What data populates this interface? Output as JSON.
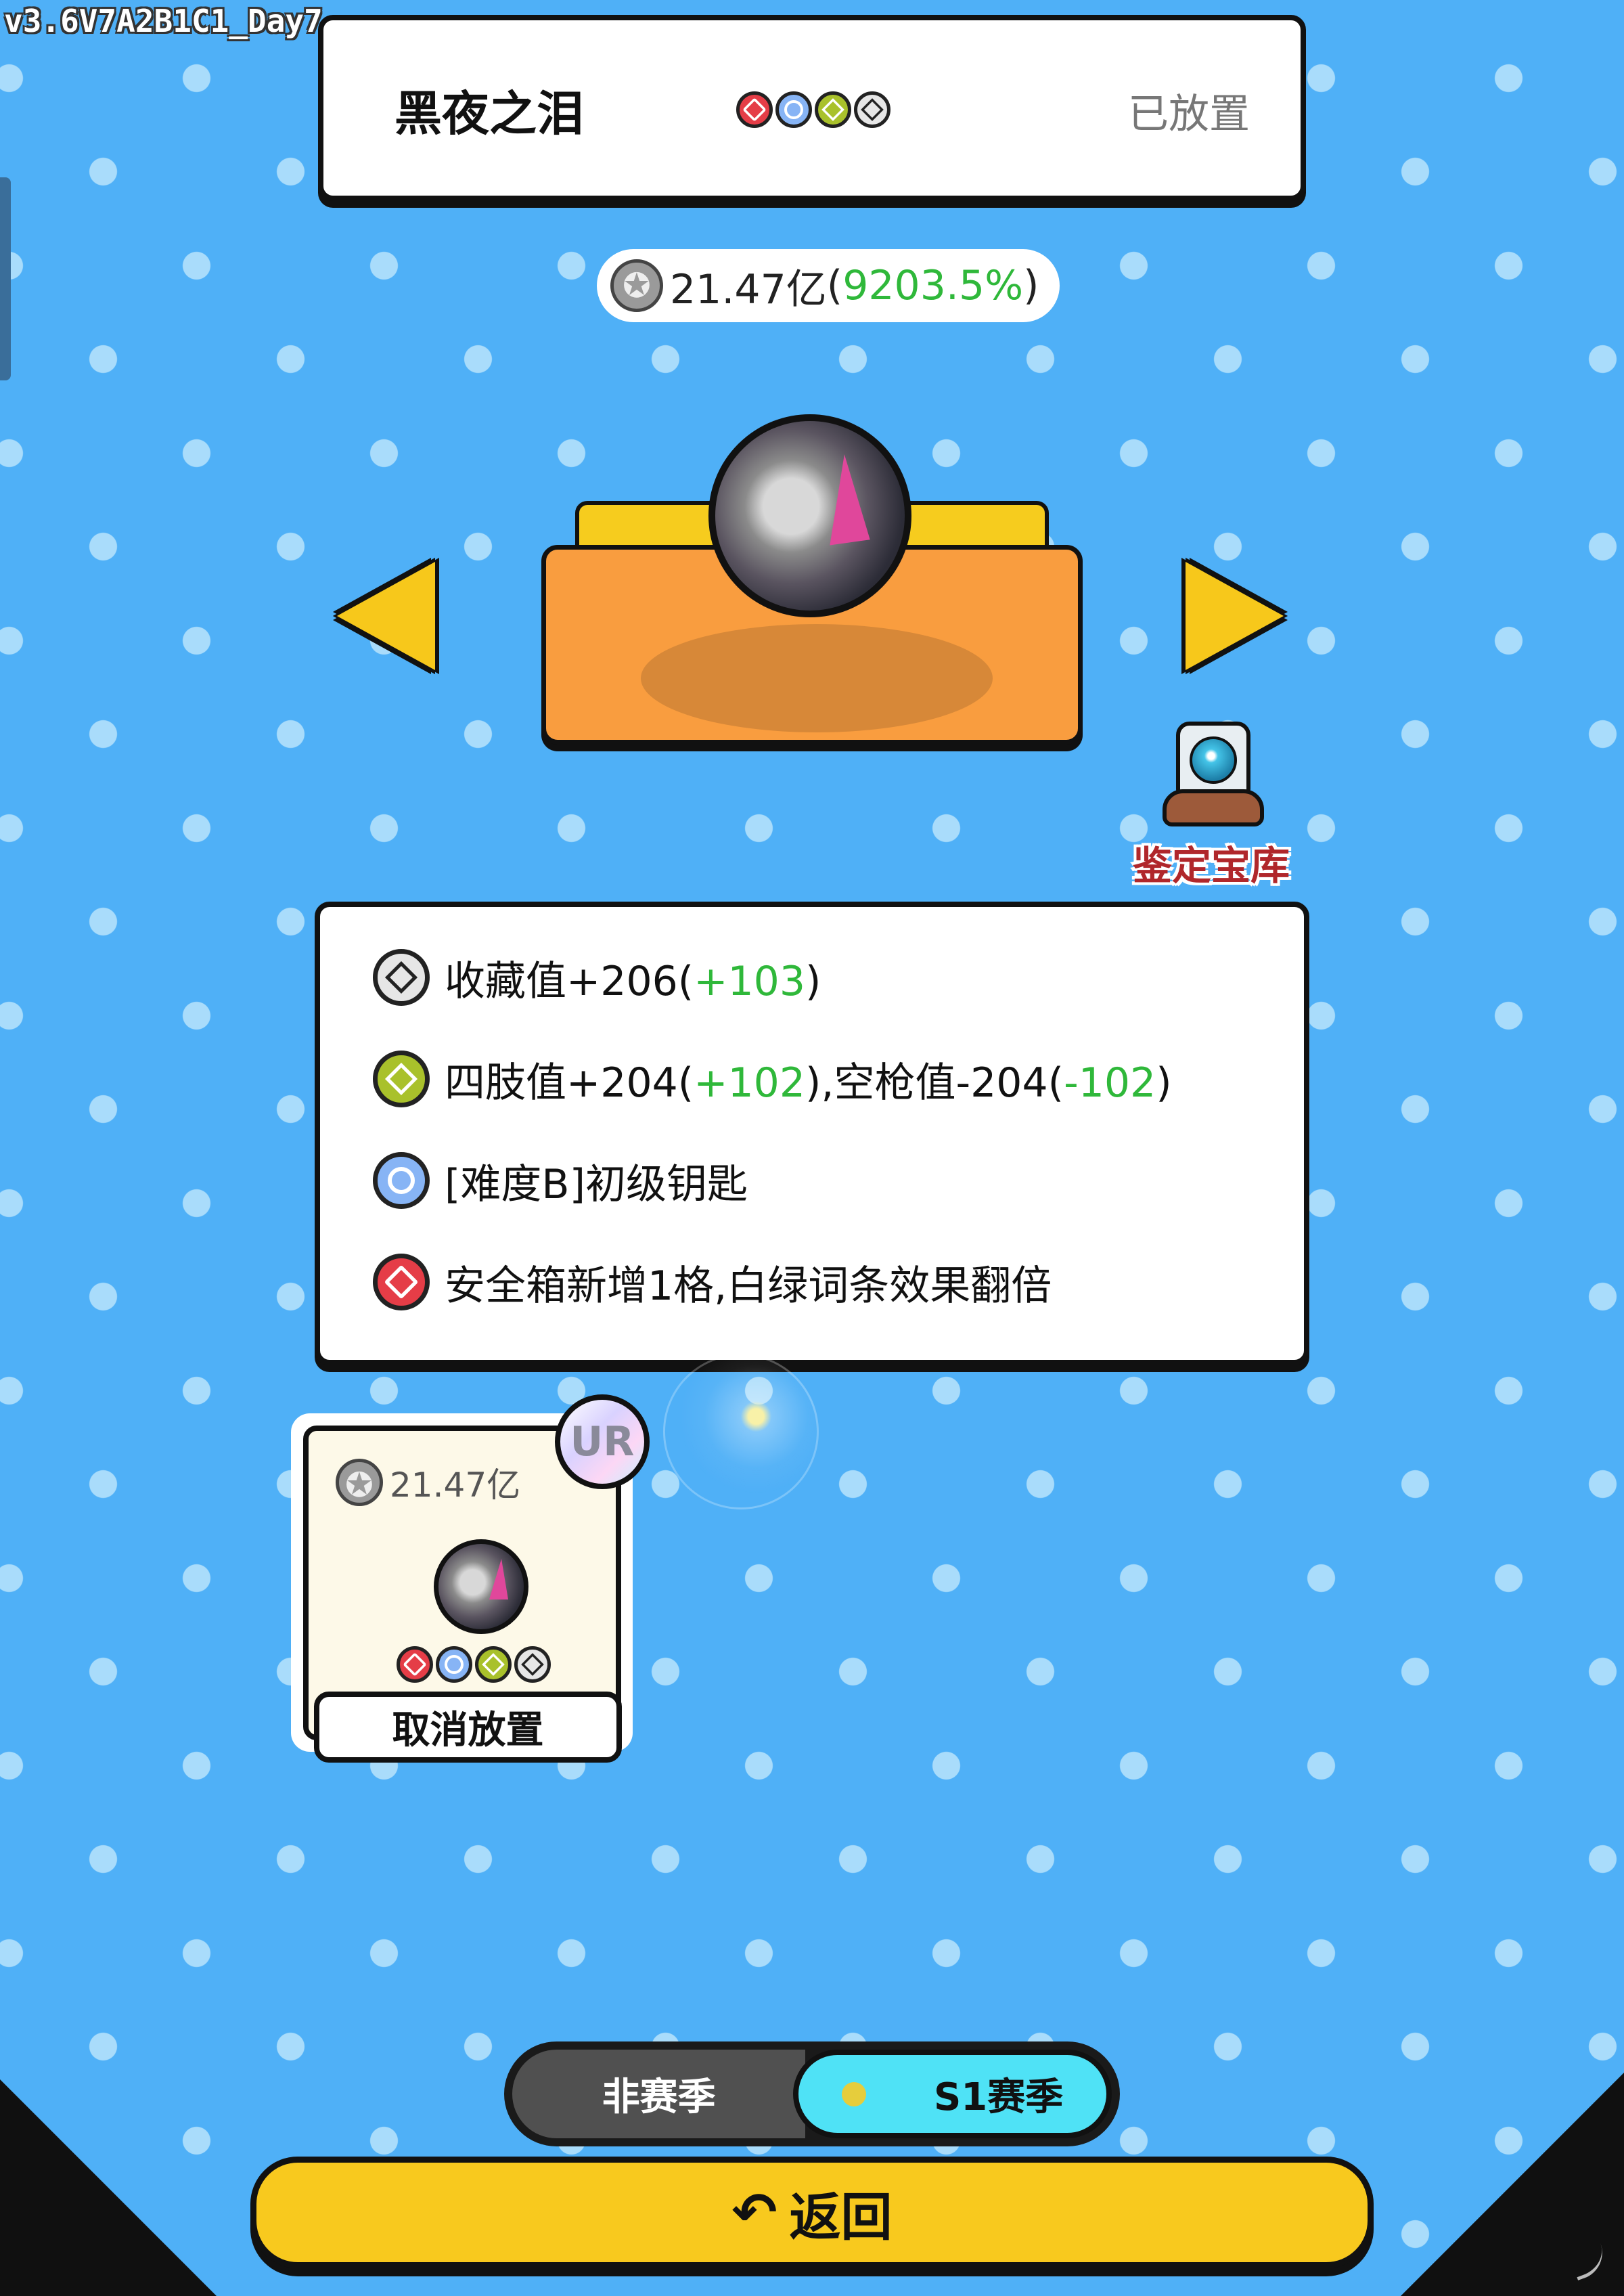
{
  "version_label": "v3.6V7A2B1C1_Day7",
  "header": {
    "title": "黑夜之泪",
    "status": "已放置",
    "gems": [
      "red",
      "blue",
      "green",
      "white"
    ]
  },
  "value": {
    "amount": "21.47亿",
    "open": "(",
    "percent": "9203.5%",
    "close": ")"
  },
  "vault": {
    "label": "鉴定宝库"
  },
  "attributes": [
    {
      "gem": "white",
      "parts": [
        {
          "t": "收藏值+206("
        },
        {
          "t": "+103",
          "c": "#2fb83a"
        },
        {
          "t": ")"
        }
      ]
    },
    {
      "gem": "green",
      "parts": [
        {
          "t": "四肢值+204("
        },
        {
          "t": "+102",
          "c": "#2fb83a"
        },
        {
          "t": "),空枪值-204("
        },
        {
          "t": "-102",
          "c": "#2fb83a"
        },
        {
          "t": ")"
        }
      ]
    },
    {
      "gem": "blue",
      "parts": [
        {
          "t": "[难度B]初级钥匙"
        }
      ]
    },
    {
      "gem": "red",
      "parts": [
        {
          "t": "安全箱新增1格,白绿词条效果翻倍"
        }
      ]
    }
  ],
  "item_card": {
    "value": "21.47亿",
    "rarity": "UR",
    "gems": [
      "red",
      "blue",
      "green",
      "white"
    ],
    "cancel_label": "取消放置"
  },
  "season": {
    "off_label": "非赛季",
    "on_label": "S1赛季"
  },
  "back_button": {
    "icon": "undo-arrow-icon",
    "label": "返回"
  },
  "colors": {
    "background": "#4fb0f7",
    "accent_yellow": "#f8c91e",
    "season_active": "#4fe2f6",
    "positive_green": "#2fb83a",
    "vault_label_red": "#b0272b"
  }
}
